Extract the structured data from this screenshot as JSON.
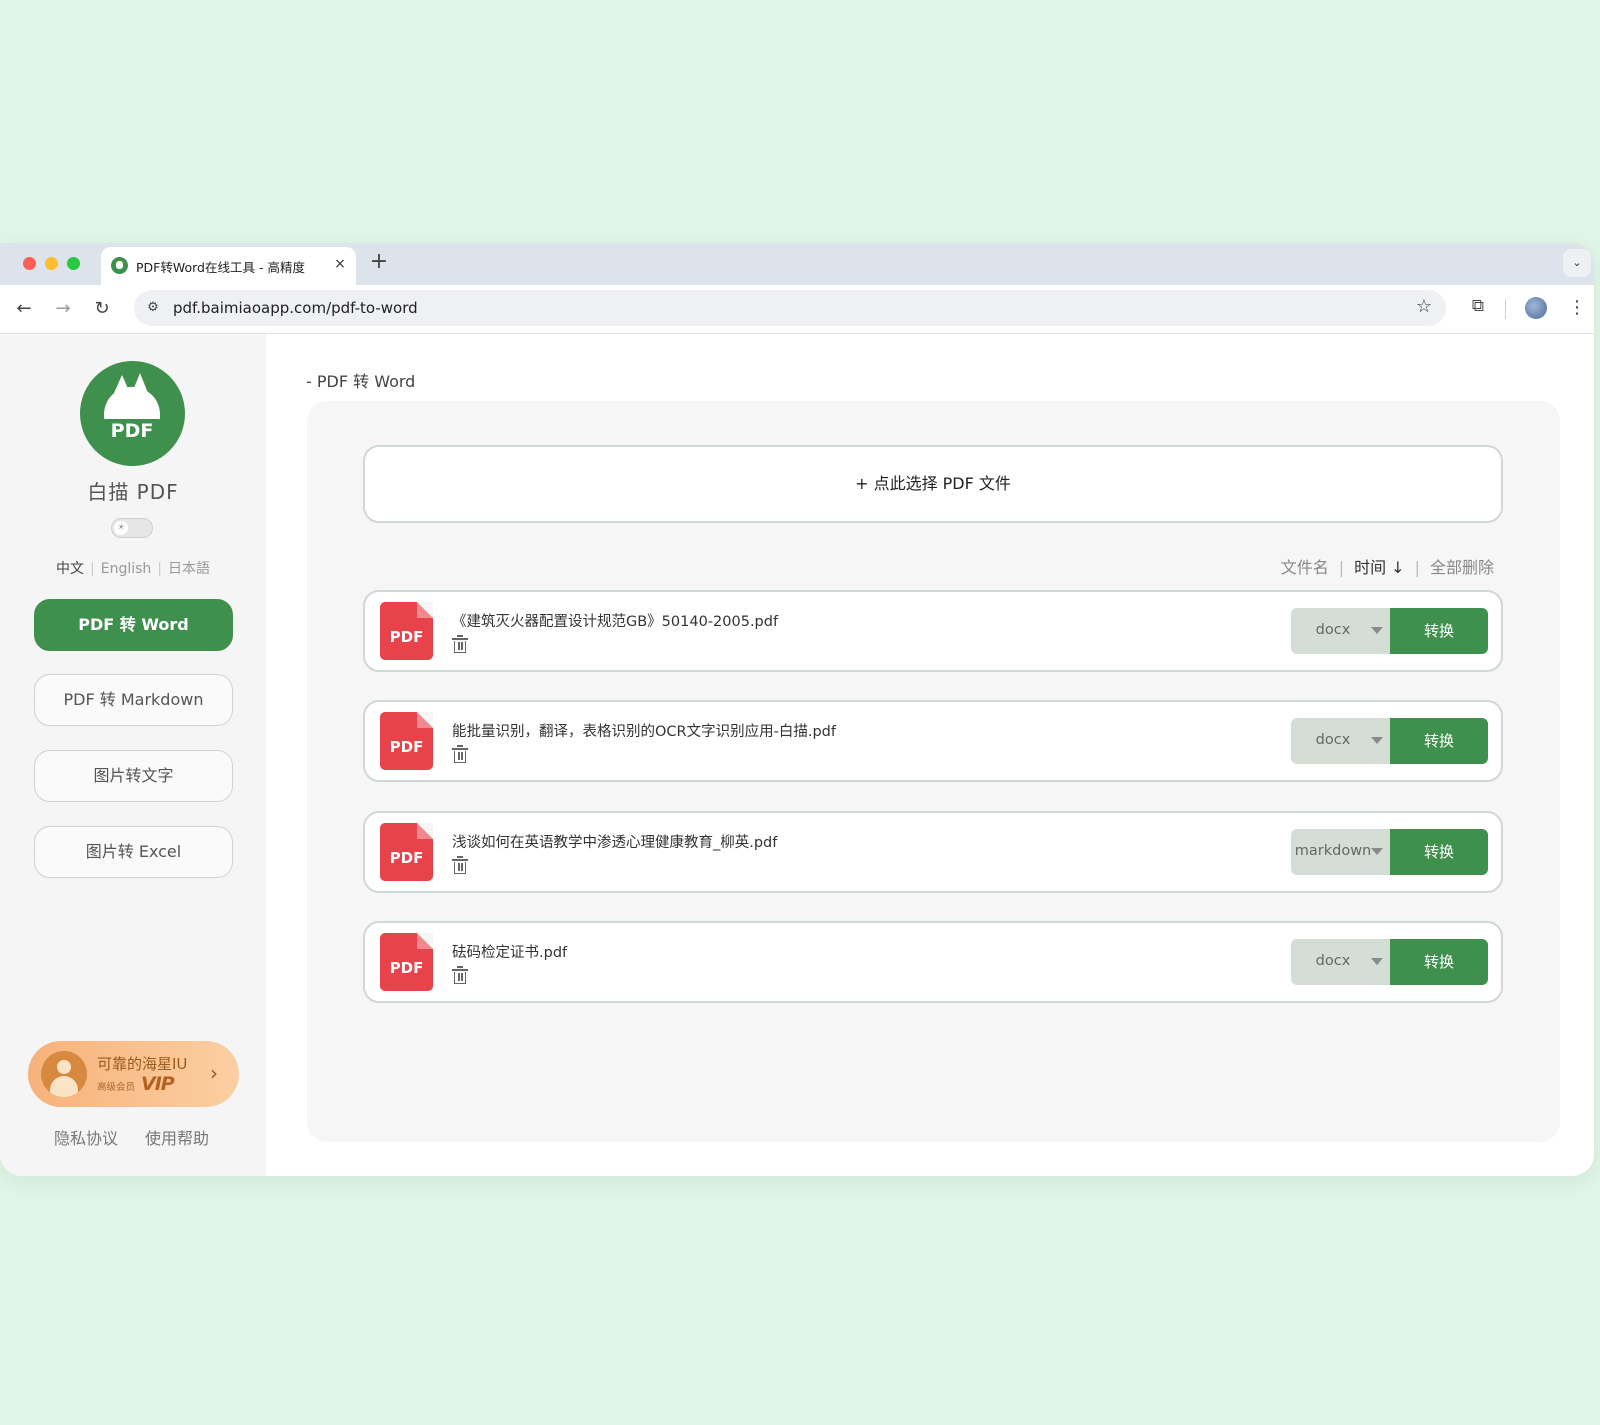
{
  "browser": {
    "tab_title": "PDF转Word在线工具 - 高精度",
    "tab_close": "×",
    "new_tab": "+",
    "tab_menu": "⌄",
    "url": "pdf.baimiaoapp.com/pdf-to-word",
    "icons": {
      "back": "←",
      "forward": "→",
      "reload": "↻",
      "site_info": "⚙",
      "bookmark": "☆",
      "extensions": "⧉",
      "menu": "⋮"
    }
  },
  "sidebar": {
    "logo_text": "PDF",
    "brand": "白描 PDF",
    "theme_icon": "☀",
    "languages": [
      "中文",
      "English",
      "日本語"
    ],
    "nav_items": [
      {
        "label": "PDF 转 Word",
        "active": true
      },
      {
        "label": "PDF 转 Markdown",
        "active": false
      },
      {
        "label": "图片转文字",
        "active": false
      },
      {
        "label": "图片转 Excel",
        "active": false
      }
    ],
    "vip": {
      "name": "可靠的海星IU",
      "tier": "高级会员",
      "badge": "VIP",
      "arrow": "›"
    },
    "footer": {
      "privacy": "隐私协议",
      "help": "使用帮助"
    }
  },
  "main": {
    "breadcrumb": "- PDF 转 Word",
    "upload_label": "+ 点此选择 PDF 文件",
    "sort": {
      "by_name": "文件名",
      "by_time": "时间 ↓",
      "delete_all": "全部删除"
    },
    "files": [
      {
        "name": "《建筑灭火器配置设计规范GB》50140-2005.pdf",
        "format": "docx",
        "convert_label": "转换",
        "icon_label": "PDF"
      },
      {
        "name": "能批量识别，翻译，表格识别的OCR文字识别应用-白描.pdf",
        "format": "docx",
        "convert_label": "转换",
        "icon_label": "PDF"
      },
      {
        "name": "浅谈如何在英语教学中渗透心理健康教育_柳英.pdf",
        "format": "markdown",
        "convert_label": "转换",
        "icon_label": "PDF"
      },
      {
        "name": "砝码检定证书.pdf",
        "format": "docx",
        "convert_label": "转换",
        "icon_label": "PDF"
      }
    ]
  },
  "colors": {
    "brand_green": "#3f8f4d",
    "pdf_red": "#e8434a",
    "vip_orange": "#f7b27a",
    "background_mint": "#e0f7e7"
  }
}
